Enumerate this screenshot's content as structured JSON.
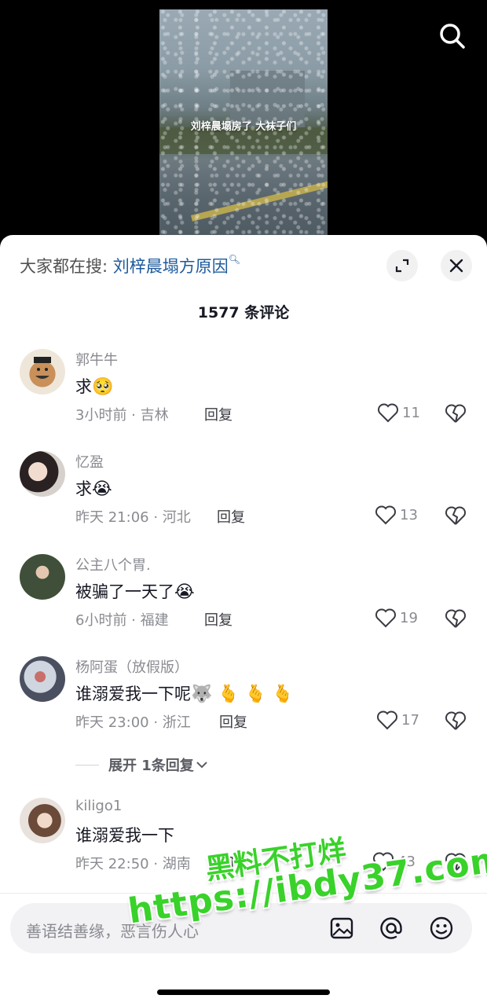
{
  "video": {
    "caption": "刘梓晨塌房了 大袜子们"
  },
  "sheet": {
    "hot_search_prefix": "大家都在搜: ",
    "hot_search_keyword": "刘梓晨塌方原因",
    "comment_count_title": "1577 条评论"
  },
  "comments": [
    {
      "username": "郭牛牛",
      "text": "求",
      "emoji": "🥺",
      "time_location": "3小时前 · 吉林",
      "reply_label": "回复",
      "likes": "11"
    },
    {
      "username": "忆盈",
      "text": "求",
      "emoji": "😭",
      "time_location": "昨天 21:06 · 河北",
      "reply_label": "回复",
      "likes": "13"
    },
    {
      "username": "公主八个胃.",
      "text": "被骗了一天了",
      "emoji": "😭",
      "time_location": "6小时前 · 福建",
      "reply_label": "回复",
      "likes": "19"
    },
    {
      "username": "杨阿蛋（放假版）",
      "text": "谁溺爱我一下呢",
      "emoji": "🐺 🫰 🫰 🫰",
      "time_location": "昨天 23:00 · 浙江",
      "reply_label": "回复",
      "likes": "17"
    },
    {
      "username": "kiligo1",
      "text": "谁溺爱我一下",
      "emoji": "",
      "time_location": "昨天 22:50 · 湖南",
      "reply_label": "回复",
      "likes": "43"
    }
  ],
  "expand_replies": "展开 1条回复",
  "input": {
    "placeholder": "善语结善缘，恶言伤人心"
  },
  "watermark": {
    "line1": "黑料不打烊",
    "line2": "https://ibdy37.com"
  },
  "icons": {
    "search": "search-icon",
    "expand": "expand-icon",
    "close": "close-icon",
    "like": "heart-outline-icon",
    "dislike": "broken-heart-icon",
    "image": "image-icon",
    "mention": "at-icon",
    "emoji": "emoji-icon",
    "chevron": "chevron-down-icon"
  },
  "colors": {
    "keyword_link": "#1d5a9c",
    "watermark_green": "#39d22a"
  }
}
